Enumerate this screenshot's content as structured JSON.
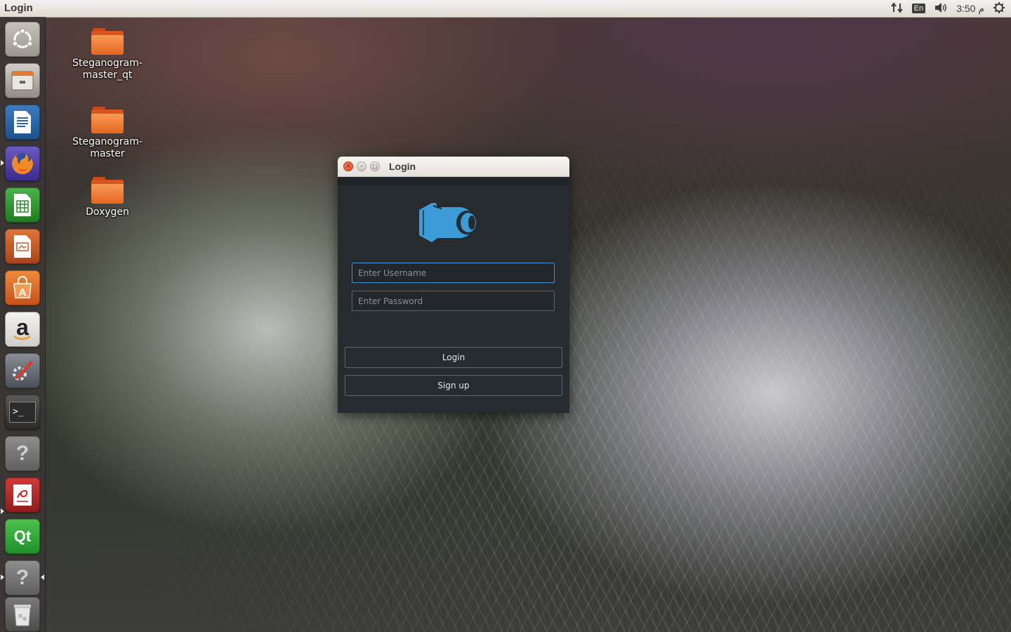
{
  "topbar": {
    "title": "Login",
    "time": "3:50 م",
    "lang": "En",
    "tray_icons": [
      "network-arrows-icon",
      "keyboard-lang-icon",
      "volume-icon",
      "power-gear-icon"
    ]
  },
  "launcher": {
    "items": [
      {
        "name": "ubuntu-dash-icon"
      },
      {
        "name": "files-icon"
      },
      {
        "name": "libreoffice-writer-icon"
      },
      {
        "name": "firefox-icon"
      },
      {
        "name": "libreoffice-calc-icon"
      },
      {
        "name": "libreoffice-impress-icon"
      },
      {
        "name": "software-center-icon"
      },
      {
        "name": "amazon-icon",
        "glyph": "a"
      },
      {
        "name": "system-settings-icon"
      },
      {
        "name": "terminal-icon",
        "glyph": ">_"
      },
      {
        "name": "unknown-app-icon",
        "glyph": "?"
      },
      {
        "name": "text-editor-icon"
      },
      {
        "name": "qt-creator-icon",
        "glyph": "Qt"
      },
      {
        "name": "unknown-app-icon-2",
        "glyph": "?"
      },
      {
        "name": "trash-icon"
      }
    ]
  },
  "desktop": {
    "icons": [
      {
        "label": "Steganogram-master_qt"
      },
      {
        "label": "Steganogram-master"
      },
      {
        "label": "Doxygen"
      }
    ]
  },
  "dialog": {
    "title": "Login",
    "username_placeholder": "Enter Username",
    "password_placeholder": "Enter Password",
    "login_label": "Login",
    "signup_label": "Sign up",
    "accent_color": "#3d9cd8"
  }
}
